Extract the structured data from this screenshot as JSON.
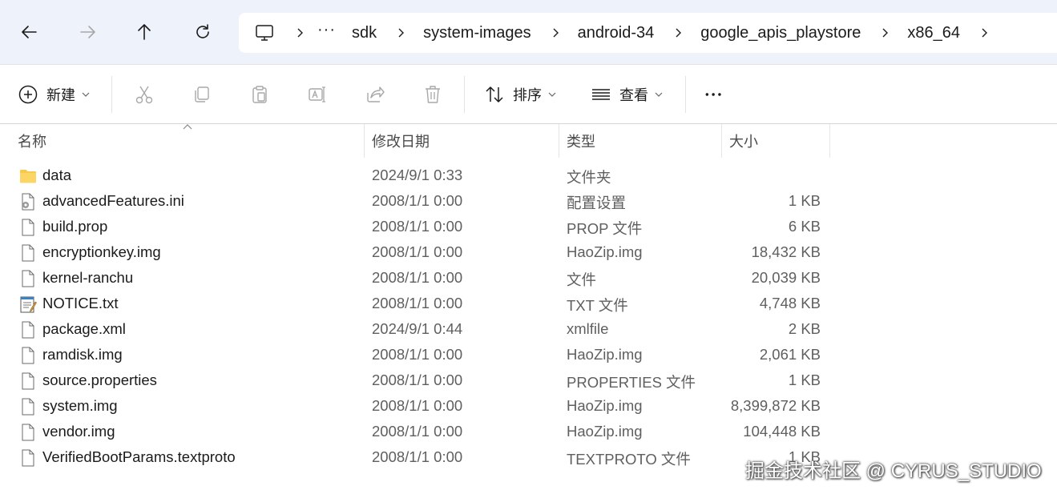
{
  "nav": {
    "breadcrumbs": [
      "sdk",
      "system-images",
      "android-34",
      "google_apis_playstore",
      "x86_64"
    ],
    "overflow": "···"
  },
  "toolbar": {
    "new_label": "新建",
    "sort_label": "排序",
    "view_label": "查看",
    "more_label": "···"
  },
  "columns": {
    "name": "名称",
    "date": "修改日期",
    "type": "类型",
    "size": "大小"
  },
  "files": [
    {
      "icon": "folder-icon",
      "name": "data",
      "date": "2024/9/1 0:33",
      "type": "文件夹",
      "size": ""
    },
    {
      "icon": "settings-file-icon",
      "name": "advancedFeatures.ini",
      "date": "2008/1/1 0:00",
      "type": "配置设置",
      "size": "1 KB"
    },
    {
      "icon": "file-icon",
      "name": "build.prop",
      "date": "2008/1/1 0:00",
      "type": "PROP 文件",
      "size": "6 KB"
    },
    {
      "icon": "file-icon",
      "name": "encryptionkey.img",
      "date": "2008/1/1 0:00",
      "type": "HaoZip.img",
      "size": "18,432 KB"
    },
    {
      "icon": "file-icon",
      "name": "kernel-ranchu",
      "date": "2008/1/1 0:00",
      "type": "文件",
      "size": "20,039 KB"
    },
    {
      "icon": "notepad-icon",
      "name": "NOTICE.txt",
      "date": "2008/1/1 0:00",
      "type": "TXT 文件",
      "size": "4,748 KB"
    },
    {
      "icon": "file-icon",
      "name": "package.xml",
      "date": "2024/9/1 0:44",
      "type": "xmlfile",
      "size": "2 KB"
    },
    {
      "icon": "file-icon",
      "name": "ramdisk.img",
      "date": "2008/1/1 0:00",
      "type": "HaoZip.img",
      "size": "2,061 KB"
    },
    {
      "icon": "file-icon",
      "name": "source.properties",
      "date": "2008/1/1 0:00",
      "type": "PROPERTIES 文件",
      "size": "1 KB"
    },
    {
      "icon": "file-icon",
      "name": "system.img",
      "date": "2008/1/1 0:00",
      "type": "HaoZip.img",
      "size": "8,399,872 KB"
    },
    {
      "icon": "file-icon",
      "name": "vendor.img",
      "date": "2008/1/1 0:00",
      "type": "HaoZip.img",
      "size": "104,448 KB"
    },
    {
      "icon": "file-icon",
      "name": "VerifiedBootParams.textproto",
      "date": "2008/1/1 0:00",
      "type": "TEXTPROTO 文件",
      "size": "1 KB"
    }
  ],
  "watermark": "掘金技术社区 @ CYRUS_STUDIO",
  "colors": {
    "nav_bg": "#eef3fb",
    "folder": "#f8c94a",
    "accent": "#005fb8"
  }
}
